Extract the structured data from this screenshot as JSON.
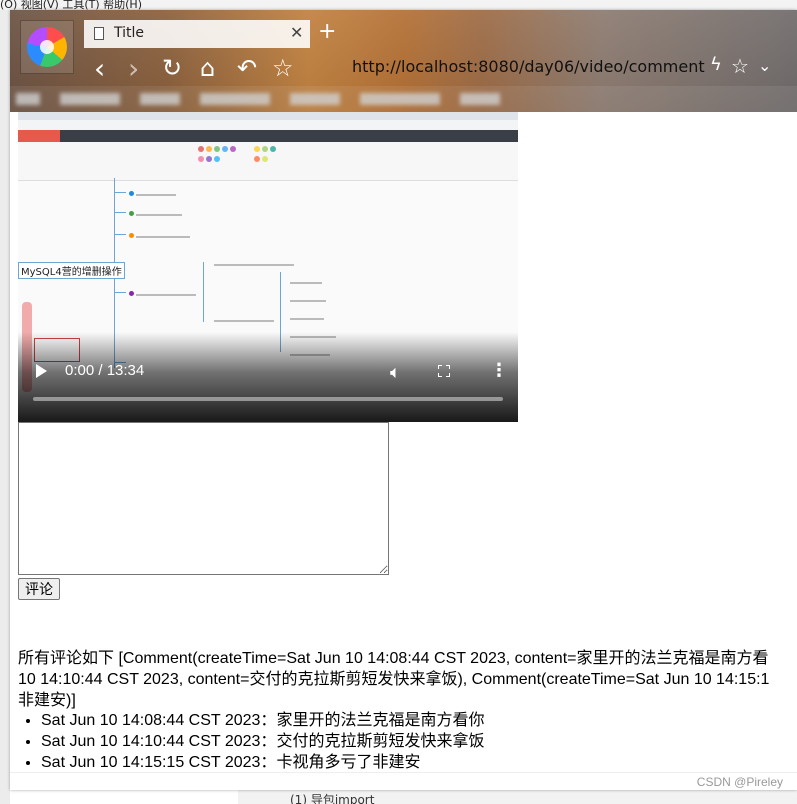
{
  "browser": {
    "tab_title": "Title",
    "url": "http://localhost:8080/day06/video/comment"
  },
  "video": {
    "time_display": "0:00 / 13:34",
    "progress": 0,
    "thumbnail_root_label": "MySQL4营的增删操作"
  },
  "form": {
    "comment_value": "",
    "submit_label": "评论"
  },
  "comments_summary": [
    "所有评论如下 [Comment(createTime=Sat Jun 10 14:08:44 CST 2023, content=家里开的法兰克福是南方看",
    "10 14:10:44 CST 2023, content=交付的克拉斯剪短发快来拿饭), Comment(createTime=Sat Jun 10 14:15:1",
    "非建安)]"
  ],
  "comments": [
    {
      "time": "Sat Jun 10 14:08:44 CST 2023",
      "content": "家里开的法兰克福是南方看你"
    },
    {
      "time": "Sat Jun 10 14:10:44 CST 2023",
      "content": "交付的克拉斯剪短发快来拿饭"
    },
    {
      "time": "Sat Jun 10 14:15:15 CST 2023",
      "content": "卡视角多亏了非建安"
    }
  ],
  "watermark": "CSDN @Pireley",
  "background": {
    "top_menu_text": "(O)   视图(V)   工具(T)   帮助(H)",
    "bottom_text": "(1)   导包import"
  }
}
